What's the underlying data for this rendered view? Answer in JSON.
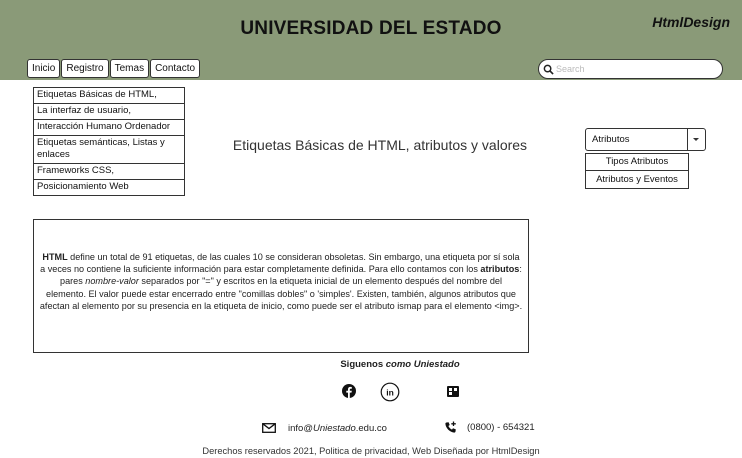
{
  "header": {
    "title": "UNIVERSIDAD DEL ESTADO",
    "brand": "HtmlDesign",
    "bg_color": "#8a9a78"
  },
  "nav": {
    "items": [
      {
        "label": "Inicio"
      },
      {
        "label": "Registro"
      },
      {
        "label": "Temas"
      },
      {
        "label": "Contacto"
      }
    ]
  },
  "search": {
    "placeholder": "Search",
    "value": ""
  },
  "sidebar": {
    "items": [
      {
        "label": "Etiquetas Básicas de HTML,"
      },
      {
        "label": "La interfaz de usuario,"
      },
      {
        "label": "Interacción Humano Ordenador"
      },
      {
        "label": "Etiquetas semánticas, Listas y enlaces"
      },
      {
        "label": "Frameworks CSS,"
      },
      {
        "label": "Posicionamiento Web"
      }
    ]
  },
  "main": {
    "title": "Etiquetas Básicas de HTML, atributos y valores",
    "paragraph": {
      "strong1": "HTML",
      "text1": " define un total de 91 etiquetas, de las cuales 10 se consideran obsoletas. Sin embargo, una etiqueta por sí sola a veces no contiene la suficiente información para estar completamente definida. Para ello contamos con los ",
      "strong2": "atributos",
      "text2": ": pares ",
      "em1": "nombre-valor",
      "text3": " separados por \"=\" y escritos en la etiqueta inicial de un elemento después del nombre del elemento. El valor puede estar encerrado entre \"comillas dobles\" o 'simples'. Existen, también, algunos atributos que afectan al elemento por su presencia en la etiqueta de inicio, como puede ser el atributo ismap para el elemento <img>."
    }
  },
  "select": {
    "selected": "Atributos",
    "options": [
      {
        "label": "Tipos Atributos"
      },
      {
        "label": "Atributos y Eventos"
      }
    ]
  },
  "footer": {
    "follow_prefix": "Siguenos ",
    "follow_brand": "como Uniestado",
    "social_icons": [
      "facebook-icon",
      "linkedin-icon",
      "app-icon"
    ],
    "email_user": "info@",
    "email_domain_italic": "Uniestado",
    "email_suffix": ".edu.co",
    "phone": "(0800) - 654321",
    "copyright": "Derechos reservados 2021, Politica de privacidad, Web Diseñada por HtmlDesign"
  }
}
